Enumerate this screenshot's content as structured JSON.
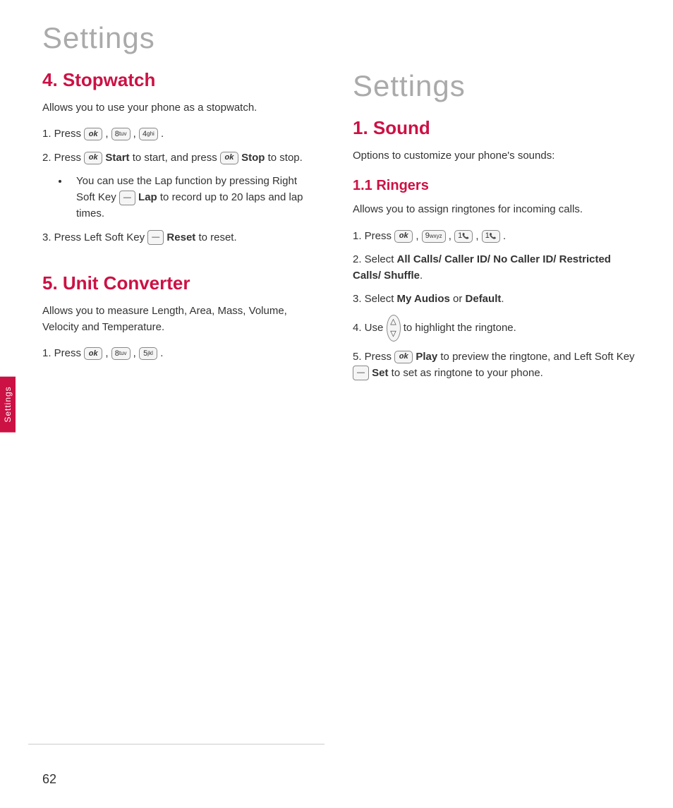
{
  "page": {
    "title": "Settings",
    "page_number": "62"
  },
  "side_tab": {
    "label": "Settings"
  },
  "left": {
    "section4": {
      "title": "4. Stopwatch",
      "description": "Allows you to use your phone as a stopwatch.",
      "steps": [
        {
          "num": "1.",
          "text": "Press",
          "keys": [
            "OK",
            "8 tuv",
            "4 ghi"
          ]
        },
        {
          "num": "2.",
          "text_parts": [
            "Press",
            "OK",
            "Start",
            "to start, and press",
            "OK",
            "Stop",
            "to stop."
          ]
        },
        {
          "bullet": "You can use the Lap function by pressing Right Soft Key",
          "key": "RSK",
          "bold_text": "Lap",
          "after": "to record up to 20 laps and lap times."
        },
        {
          "num": "3.",
          "text_parts": [
            "Press Left Soft Key",
            "LSK",
            "Reset",
            "to reset."
          ]
        }
      ]
    },
    "section5": {
      "title": "5. Unit Converter",
      "description": "Allows you to measure Length, Area, Mass, Volume, Velocity and Temperature.",
      "steps": [
        {
          "num": "1.",
          "text": "Press",
          "keys": [
            "OK",
            "8 tuv",
            "5 jkl"
          ]
        }
      ]
    }
  },
  "right": {
    "settings_title": "Settings",
    "section1": {
      "title": "1. Sound",
      "description": "Options to customize your phone's sounds:",
      "sub1": {
        "title": "1.1 Ringers",
        "description": "Allows you to assign ringtones for incoming calls.",
        "steps": [
          {
            "num": "1.",
            "text": "Press",
            "keys": [
              "OK",
              "9 wxyz",
              "1",
              "1"
            ]
          },
          {
            "num": "2.",
            "text": "Select All Calls/ Caller ID/ No Caller ID/ Restricted Calls/ Shuffle."
          },
          {
            "num": "3.",
            "text": "Select My Audios or Default."
          },
          {
            "num": "4.",
            "text": "Use",
            "key": "NAV",
            "after": "to highlight the ringtone."
          },
          {
            "num": "5.",
            "text": "Press",
            "key": "OK",
            "bold1": "Play",
            "after": "to preview the ringtone, and Left Soft Key",
            "lsk": "LSK",
            "bold2": "Set",
            "end": "to set as ringtone to your phone."
          }
        ]
      }
    }
  }
}
